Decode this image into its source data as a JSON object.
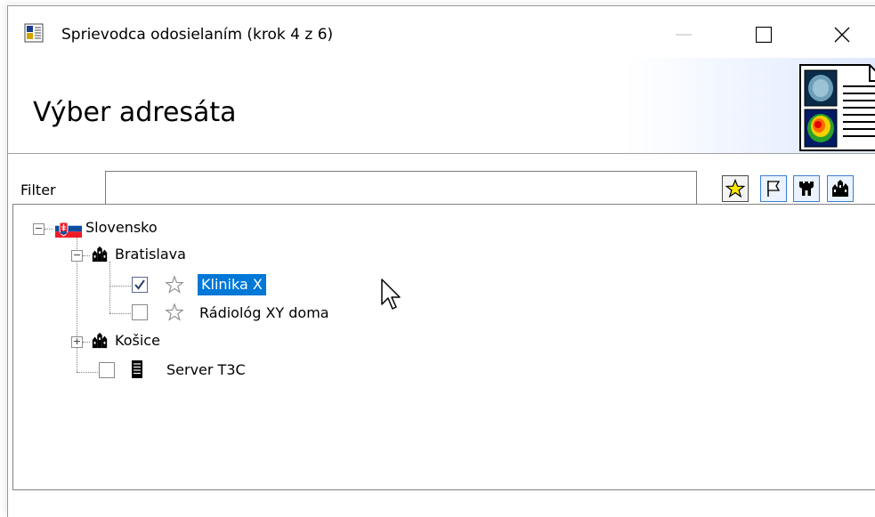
{
  "window": {
    "title": "Sprievodca odosielaním (krok 4 z 6)"
  },
  "header": {
    "title": "Výber adresáta"
  },
  "filter": {
    "label": "Filter",
    "value": "",
    "placeholder": ""
  },
  "toolbar": {
    "buttons": [
      {
        "icon": "star-icon"
      },
      {
        "icon": "flag-icon"
      },
      {
        "icon": "tower-icon"
      },
      {
        "icon": "city-icon"
      }
    ]
  },
  "tree": {
    "root": {
      "label": "Slovensko",
      "icon": "slovak-flag-icon",
      "expanded": true,
      "children": [
        {
          "label": "Bratislava",
          "icon": "city-icon",
          "expanded": true,
          "children": [
            {
              "label": "Klinika X",
              "icon": "star-outline-icon",
              "checked": true,
              "selected": true
            },
            {
              "label": "Rádiológ XY doma",
              "icon": "star-outline-icon",
              "checked": false,
              "selected": false
            }
          ]
        },
        {
          "label": "Košice",
          "icon": "city-icon",
          "expanded": false
        },
        {
          "label": "Server T3C",
          "icon": "server-icon",
          "checked": false
        }
      ]
    }
  },
  "colors": {
    "selection": "#0078d7",
    "toolbar_active_border": "#3c7fd0"
  }
}
